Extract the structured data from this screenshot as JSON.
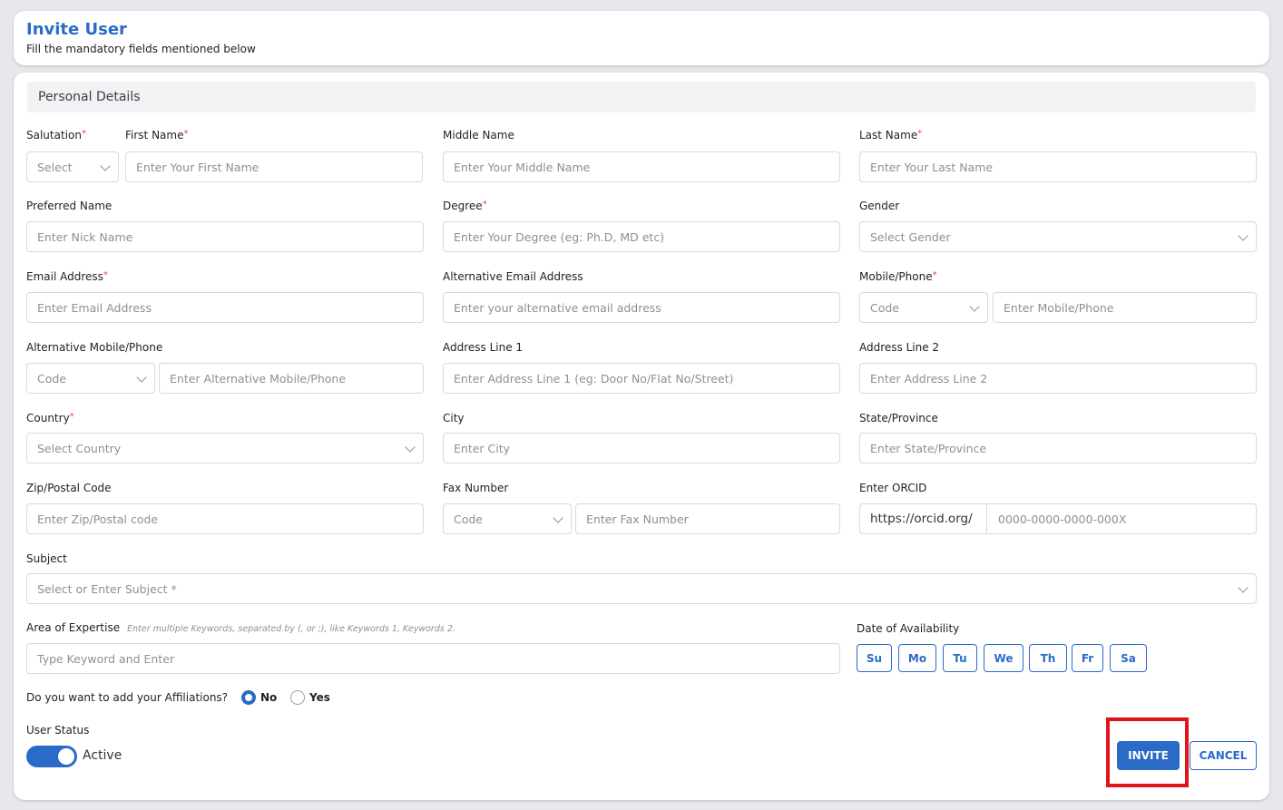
{
  "header": {
    "title": "Invite User",
    "subtitle": "Fill the mandatory fields mentioned below"
  },
  "section": {
    "title": "Personal Details"
  },
  "fields": {
    "salutation": {
      "label": "Salutation",
      "value": "Select"
    },
    "first_name": {
      "label": "First Name",
      "placeholder": "Enter Your First Name"
    },
    "middle_name": {
      "label": "Middle Name",
      "placeholder": "Enter Your Middle Name"
    },
    "last_name": {
      "label": "Last Name",
      "placeholder": "Enter Your Last Name"
    },
    "preferred_name": {
      "label": "Preferred Name",
      "placeholder": "Enter Nick Name"
    },
    "degree": {
      "label": "Degree",
      "placeholder": "Enter Your Degree (eg: Ph.D, MD etc)"
    },
    "gender": {
      "label": "Gender",
      "value": "Select Gender"
    },
    "email": {
      "label": "Email Address",
      "placeholder": "Enter Email Address"
    },
    "alt_email": {
      "label": "Alternative Email Address",
      "placeholder": "Enter your alternative email address"
    },
    "mobile": {
      "label": "Mobile/Phone",
      "code": "Code",
      "placeholder": "Enter Mobile/Phone"
    },
    "alt_mobile": {
      "label": "Alternative Mobile/Phone",
      "code": "Code",
      "placeholder": "Enter Alternative Mobile/Phone"
    },
    "address1": {
      "label": "Address Line 1",
      "placeholder": "Enter Address Line 1 (eg: Door No/Flat No/Street)"
    },
    "address2": {
      "label": "Address Line 2",
      "placeholder": "Enter Address Line 2"
    },
    "country": {
      "label": "Country",
      "value": "Select Country"
    },
    "city": {
      "label": "City",
      "placeholder": "Enter City"
    },
    "state": {
      "label": "State/Province",
      "placeholder": "Enter State/Province"
    },
    "zip": {
      "label": "Zip/Postal Code",
      "placeholder": "Enter Zip/Postal code"
    },
    "fax": {
      "label": "Fax Number",
      "code": "Code",
      "placeholder": "Enter Fax Number"
    },
    "orcid": {
      "label": "Enter ORCID",
      "prefix": "https://orcid.org/",
      "placeholder": "0000-0000-0000-000X"
    },
    "subject": {
      "label": "Subject",
      "value": "Select or Enter Subject *"
    },
    "expertise": {
      "label": "Area of Expertise",
      "hint": "Enter multiple Keywords, separated by (, or ;), like Keywords 1, Keywords 2.",
      "placeholder": "Type Keyword and Enter"
    },
    "availability": {
      "label": "Date of Availability",
      "days": [
        "Su",
        "Mo",
        "Tu",
        "We",
        "Th",
        "Fr",
        "Sa"
      ]
    }
  },
  "affiliations": {
    "question": "Do you want to add your Affiliations?",
    "options": [
      "No",
      "Yes"
    ],
    "selected": "No"
  },
  "user_status": {
    "label": "User Status",
    "value": "Active",
    "enabled": true
  },
  "actions": {
    "invite": "INVITE",
    "cancel": "CANCEL"
  },
  "colors": {
    "primary": "#2a6bc7",
    "required": "#e14b4b",
    "highlight": "#e0141b"
  },
  "required_mark": "*"
}
